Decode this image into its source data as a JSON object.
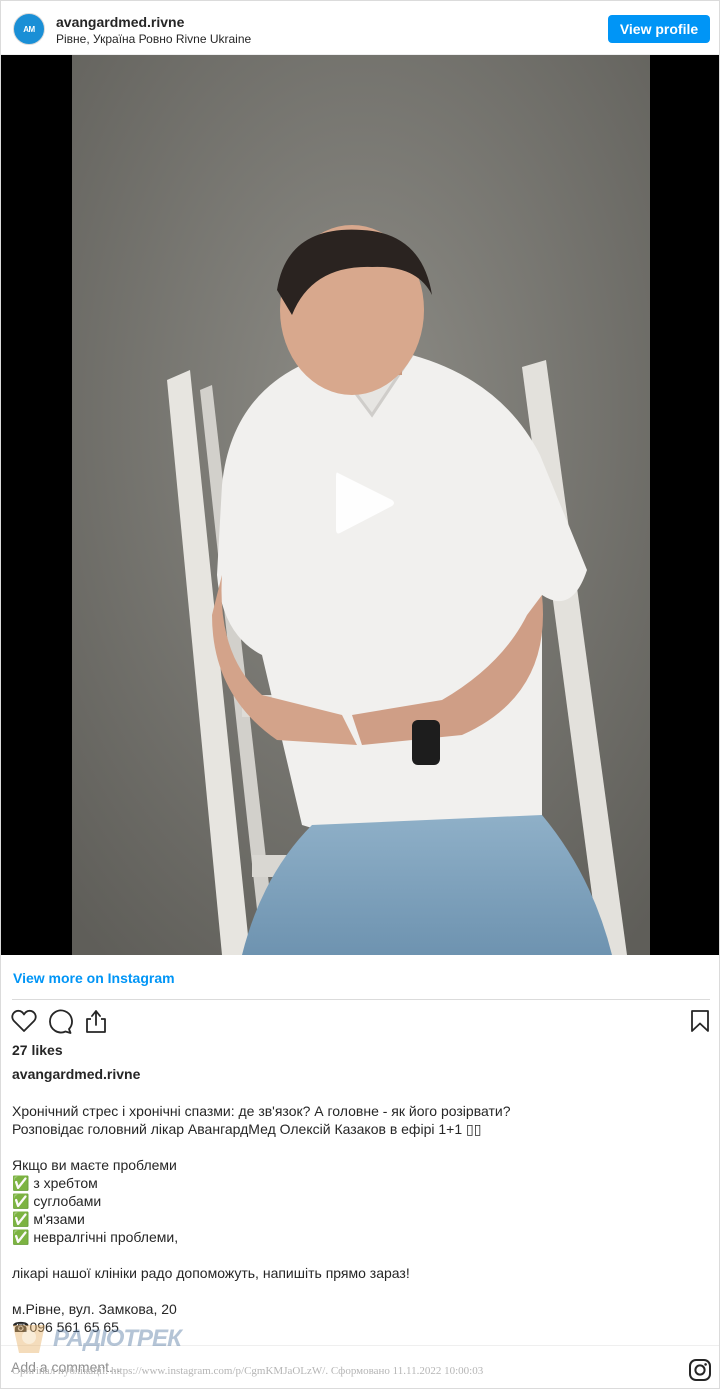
{
  "header": {
    "avatar_icon": "brand-logo-icon",
    "avatar_text": "AM",
    "username": "avangardmed.rivne",
    "location": "Рівне, Україна Ровно Rivne Ukraine",
    "view_profile_label": "View profile"
  },
  "media": {
    "type": "video",
    "play_icon": "play-icon"
  },
  "view_more_label": "View more on Instagram",
  "actions": {
    "like_icon": "heart-icon",
    "comment_icon": "comment-icon",
    "share_icon": "share-icon",
    "save_icon": "bookmark-icon"
  },
  "likes_text": "27 likes",
  "caption": {
    "username": "avangardmed.rivne",
    "lines": [
      "Хронічний стрес і хронічні спазми: де зв'язок? А головне - як його розірвати?",
      "Розповідає головний лікар АвангардМед Олексій Казаков в ефірі 1+1 ▯▯",
      "",
      "Якщо ви маєте проблеми",
      "✅ з хребтом",
      "✅ суглобами",
      "✅ м'язами",
      "✅ невралгічні проблеми,",
      "",
      "лікарі нашої клініки радо допоможуть, напишіть прямо зараз!",
      "",
      "м.Рівне, вул. Замкова, 20",
      "☎096 561 65 65"
    ]
  },
  "comment": {
    "placeholder": "Add a comment...",
    "instagram_icon": "instagram-icon"
  },
  "watermark": {
    "text": "РАДІОТРЕК"
  },
  "source_line": "Оригінал публікації: https://www.instagram.com/p/CgmKMJaOLzW/. Сформовано 11.11.2022 10:00:03",
  "colors": {
    "accent": "#0095f6",
    "text": "#262626",
    "muted": "#8e8e8e",
    "border": "#dbdbdb"
  }
}
